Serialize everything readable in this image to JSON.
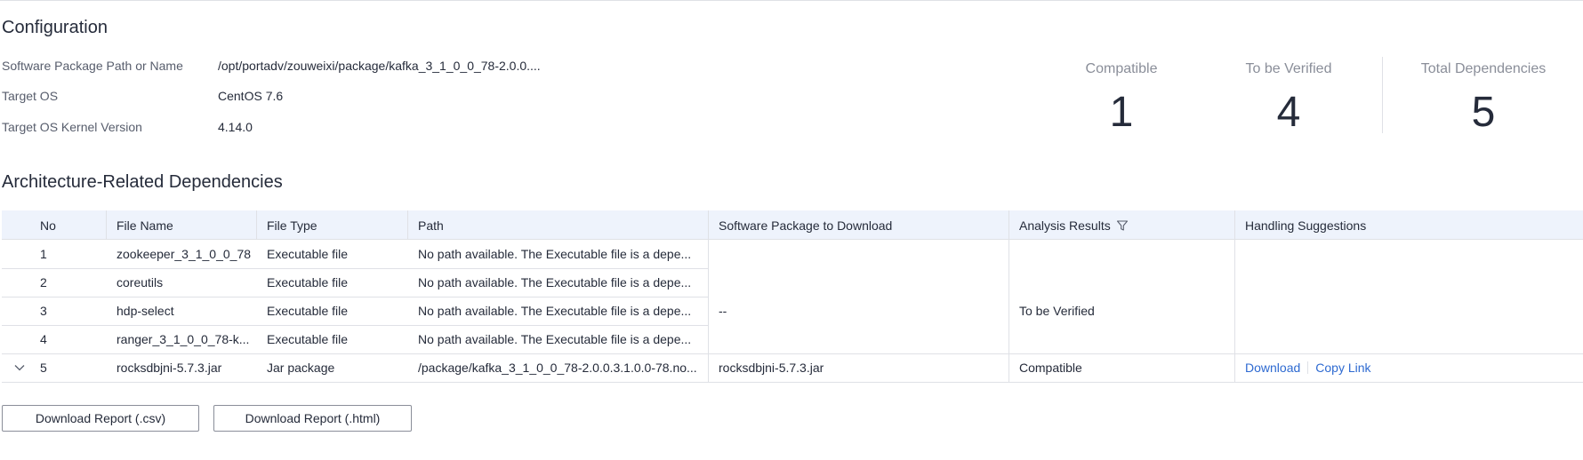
{
  "configuration": {
    "title": "Configuration",
    "fields": [
      {
        "label": "Software Package Path or Name",
        "value": "/opt/portadv/zouweixi/package/kafka_3_1_0_0_78-2.0.0...."
      },
      {
        "label": "Target OS",
        "value": "CentOS 7.6"
      },
      {
        "label": "Target OS Kernel Version",
        "value": "4.14.0"
      }
    ]
  },
  "stats": {
    "compatible": {
      "label": "Compatible",
      "value": "1"
    },
    "to_be_verified": {
      "label": "To be Verified",
      "value": "4"
    },
    "total": {
      "label": "Total Dependencies",
      "value": "5"
    }
  },
  "dependencies": {
    "title": "Architecture-Related Dependencies",
    "columns": [
      "No",
      "File Name",
      "File Type",
      "Path",
      "Software Package to Download",
      "Analysis Results",
      "Handling Suggestions"
    ],
    "rows": [
      {
        "no": "1",
        "file_name": "zookeeper_3_1_0_0_78",
        "file_type": "Executable file",
        "path": "No path available. The Executable file is a depe..."
      },
      {
        "no": "2",
        "file_name": "coreutils",
        "file_type": "Executable file",
        "path": "No path available. The Executable file is a depe..."
      },
      {
        "no": "3",
        "file_name": "hdp-select",
        "file_type": "Executable file",
        "path": "No path available. The Executable file is a depe..."
      },
      {
        "no": "4",
        "file_name": "ranger_3_1_0_0_78-k...",
        "file_type": "Executable file",
        "path": "No path available. The Executable file is a depe..."
      },
      {
        "no": "5",
        "file_name": "rocksdbjni-5.7.3.jar",
        "file_type": "Jar package",
        "path": "/package/kafka_3_1_0_0_78-2.0.0.3.1.0.0-78.no...",
        "package": "rocksdbjni-5.7.3.jar",
        "result": "Compatible",
        "download_label": "Download",
        "copy_label": "Copy Link"
      }
    ],
    "group": {
      "package": "--",
      "result": "To be Verified"
    }
  },
  "buttons": {
    "csv": "Download Report (.csv)",
    "html": "Download Report (.html)"
  },
  "colors": {
    "link": "#2e6ad1",
    "header_bg": "#eef3fc",
    "border": "#dfe1e6"
  }
}
